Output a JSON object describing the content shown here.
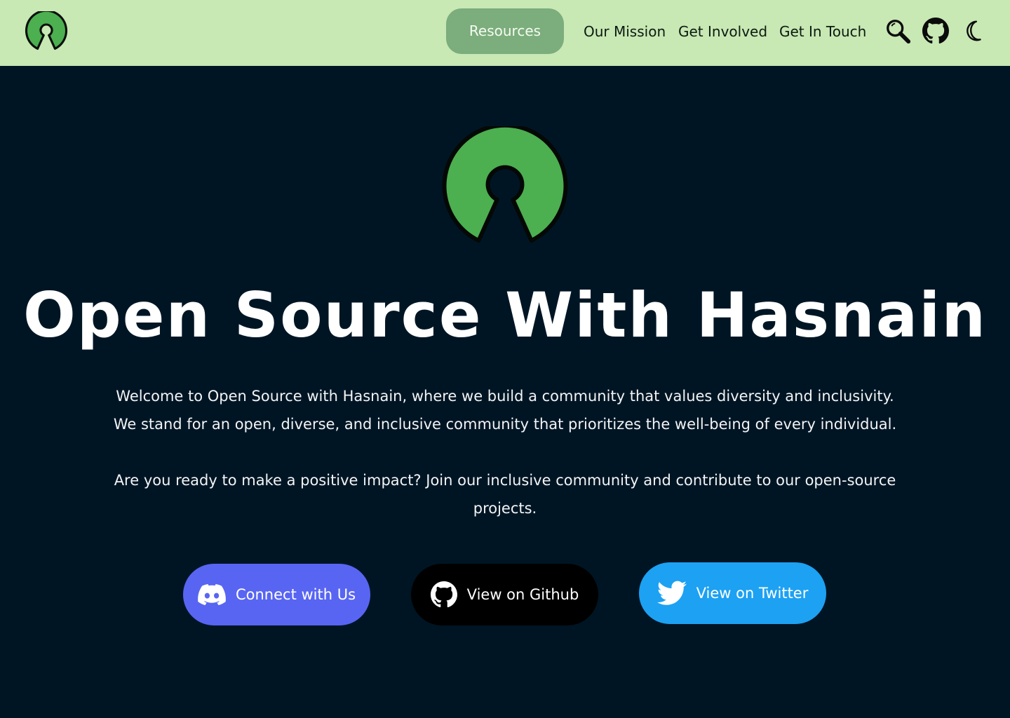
{
  "nav": {
    "links": [
      {
        "label": "Resources"
      },
      {
        "label": "Our Mission"
      },
      {
        "label": "Get Involved"
      },
      {
        "label": "Get In Touch"
      }
    ],
    "icons": [
      "search-icon",
      "github-icon",
      "moon-icon"
    ],
    "background_color": "#c8e8b4",
    "active_link_color": "#7cad7c"
  },
  "hero": {
    "title": "Open Source With Hasnain",
    "paragraph_1_line_1": "Welcome to Open Source with Hasnain, where we build a community that values diversity and inclusivity.",
    "paragraph_1_line_2": "We stand for an open, diverse, and inclusive community that prioritizes the well-being of every individual.",
    "paragraph_2": "Are you ready to make a positive impact? Join our inclusive community and contribute to our open-source projects.",
    "background_color": "#001524",
    "logo_color": "#4caf50"
  },
  "buttons": [
    {
      "label": "Connect with Us",
      "icon": "discord-icon",
      "color": "#5865f2"
    },
    {
      "label": "View on Github",
      "icon": "github-icon",
      "color": "#000000"
    },
    {
      "label": "View on Twitter",
      "icon": "twitter-icon",
      "color": "#1da1f2"
    }
  ]
}
